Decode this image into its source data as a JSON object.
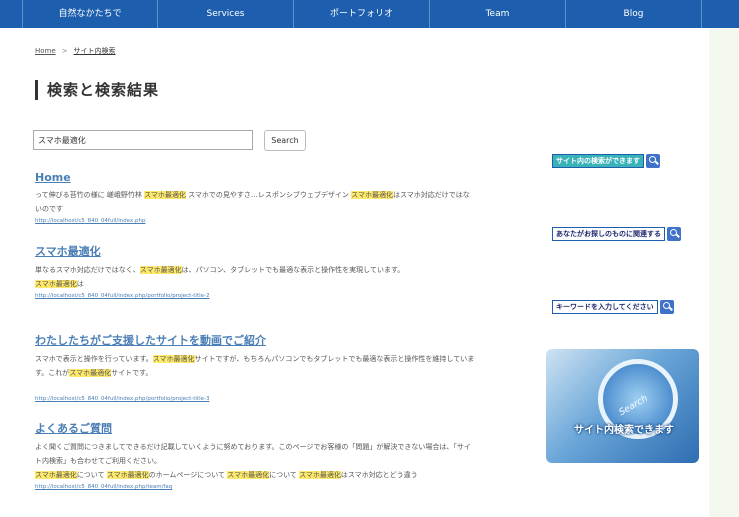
{
  "nav": {
    "items": [
      "自然なかたちで",
      "Services",
      "ポートフォリオ",
      "Team",
      "Blog"
    ]
  },
  "breadcrumb": {
    "home": "Home",
    "separator": ">",
    "current": "サイト内検索"
  },
  "page_title": "検索と検索結果",
  "search": {
    "value": "スマホ最適化",
    "button_label": "Search"
  },
  "results": [
    {
      "title": "Home",
      "snippet_parts": [
        "って伸びる苔竹の様に 嵯峨野竹林 ",
        "スマホ最適化",
        " スマホでの見やすさ…レスポンシブウェブデザイン ",
        "スマホ最適化",
        "はスマホ対応だけではないのです"
      ],
      "url": "http://localhost/c5_840_04full/index.php"
    },
    {
      "title": "スマホ最適化",
      "snippet_parts": [
        "単なるスマホ対応だけではなく、",
        "スマホ最適化",
        "は、パソコン、タブレットでも最適な表示と操作性を実現しています。"
      ],
      "snippet_line2_parts": [
        "スマホ最適化",
        "は"
      ],
      "url": "http://localhost/c5_840_04full/index.php/portfolio/project-title-2"
    },
    {
      "title": "わたしたちがご支援したサイトを動画でご紹介",
      "snippet_parts": [
        "スマホで表示と操作を行っています。",
        "スマホ最適化",
        "サイトですが、もちろんパソコンでもタブレットでも最適な表示と操作性を維持しています。これが",
        "スマホ最適化",
        "サイトです。"
      ],
      "url": "http://localhost/c5_840_04full/index.php/portfolio/project-title-3"
    },
    {
      "title": "よくあるご質問",
      "snippet_line1": "よく聞くご質問につきましてできるだけ記載していくように努めております。このページでお客様の「問題」が解決できない場合は、「サイト内検索」も合わせてご利用ください。",
      "snippet_parts": [
        "スマホ最適化",
        "について ",
        "スマホ最適化",
        "のホームページについて ",
        "スマホ最適化",
        "について ",
        "スマホ最適化",
        "はスマホ対応とどう違う"
      ],
      "url": "http://localhost/c5_840_04full/index.php/team/faq"
    }
  ],
  "sidebar": {
    "banners": [
      {
        "label": "サイト内の検索ができます",
        "style": "teal",
        "icon": "search-icon"
      },
      {
        "label": "あなたがお探しのものに関連する",
        "style": "white",
        "icon": "search-icon"
      },
      {
        "label": "キーワードを入力してください",
        "style": "white",
        "icon": "search-icon"
      }
    ],
    "image_caption": "サイト内検索できます",
    "image_word": "Search"
  },
  "colors": {
    "nav_bg": "#1d5fae",
    "page_bg": "#f3f9ee",
    "link": "#4a7fb5",
    "highlight": "#ffe96a"
  }
}
